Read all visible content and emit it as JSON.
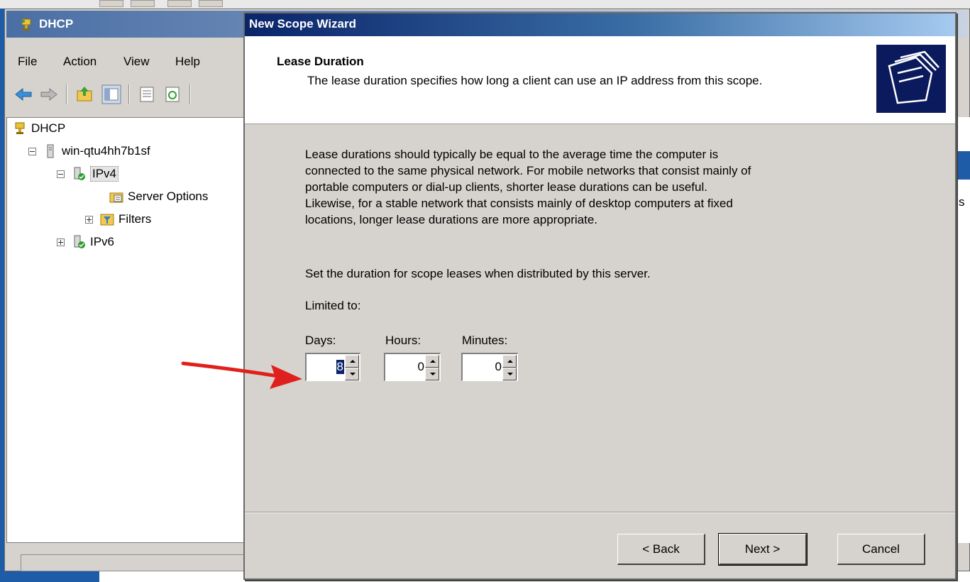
{
  "mmc": {
    "title": "DHCP",
    "menu": [
      "File",
      "Action",
      "View",
      "Help"
    ],
    "tree": {
      "root": "DHCP",
      "server": "win-qtu4hh7b1sf",
      "ipv4": "IPv4",
      "server_options": "Server Options",
      "filters": "Filters",
      "ipv6": "IPv6"
    },
    "right_peek_char": "s"
  },
  "wizard": {
    "title": "New Scope Wizard",
    "header_title": "Lease Duration",
    "header_subtitle": "The lease duration specifies how long a client can use an IP address from this scope.",
    "description_lines": [
      "Lease durations should typically be equal to the average time the computer is",
      "connected to the same physical network. For mobile networks that consist mainly of",
      "portable computers or dial-up clients, shorter lease durations can be useful.",
      "Likewise, for a stable network that consists mainly of desktop computers at fixed",
      "locations, longer lease durations are more appropriate."
    ],
    "set_duration_text": "Set the duration for scope leases when distributed by this server.",
    "limited_to_label": "Limited to:",
    "days": {
      "label": "Days:",
      "value": "8"
    },
    "hours": {
      "label": "Hours:",
      "value": "0"
    },
    "minutes": {
      "label": "Minutes:",
      "value": "0"
    },
    "buttons": {
      "back": "< Back",
      "next": "Next >",
      "cancel": "Cancel"
    }
  },
  "colors": {
    "dialog_bg": "#d6d3ce",
    "wizard_titlebar_start": "#0a246a",
    "annotation_arrow": "#e0201c"
  }
}
